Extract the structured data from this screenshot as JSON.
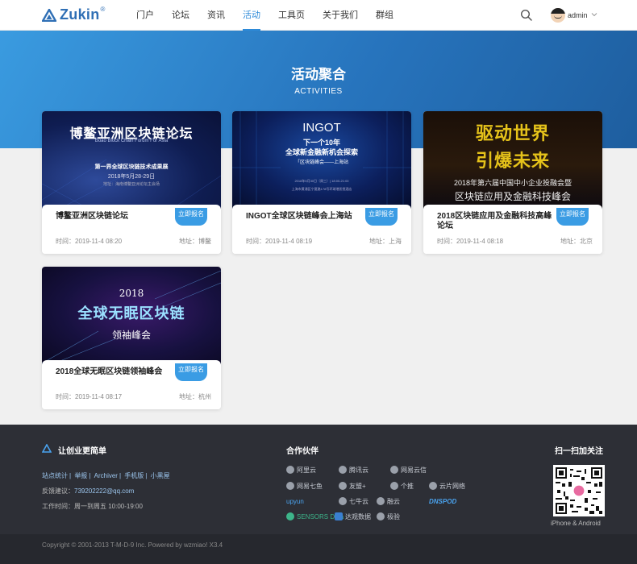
{
  "header": {
    "logo_text": "Zukin",
    "logo_mark": "®",
    "nav": [
      "门户",
      "论坛",
      "资讯",
      "活动",
      "工具页",
      "关于我们",
      "群组"
    ],
    "active_nav": "活动",
    "search_icon": "search-icon",
    "user": "admin"
  },
  "banner": {
    "title": "活动聚合",
    "subtitle": "ACTIVITIES"
  },
  "cards": [
    {
      "title": "博鳌亚洲区块链论坛",
      "badge": "立即报名",
      "time": "时间：2019-11-4 08:20",
      "address": "地址：博鳌",
      "image_text": [
        "博鳌亚洲区块链论坛",
        "Boao Block Chain Forum For Asia",
        "第一界全球区块链技术成果展",
        "2018年5月28-29日",
        "地址：海南博鳌亚洲论坛主会场"
      ]
    },
    {
      "title": "INGOT全球区块链峰会上海站",
      "badge": "立即报名",
      "time": "时间：2019-11-4 08:19",
      "address": "地址：上海",
      "image_text": [
        "INGOT",
        "下一个10年",
        "全球新金融新机会探索",
        "「区块链峰会——上海站",
        "2018年5月30日（周三）| 18:00-21:00",
        "上海市黄浦区宁夏路178号环球港凯悦酒店"
      ]
    },
    {
      "title": "2018区块链应用及金融科技高峰论坛",
      "badge": "立即报名",
      "time": "时间：2019-11-4 08:18",
      "address": "地址：北京",
      "image_text": [
        "驱动世界",
        "引爆未来",
        "2018年第六届中国中小企业投融会暨",
        "区块链应用及金融科技峰会"
      ]
    },
    {
      "title": "2018全球无眠区块链领袖峰会",
      "badge": "立即报名",
      "time": "时间：2019-11-4 08:17",
      "address": "地址：杭州",
      "image_text": [
        "2018",
        "全球无眠区块链",
        "领袖峰会"
      ]
    }
  ],
  "footer": {
    "slogan": "让创业更简单",
    "links": [
      "站点统计",
      "举报",
      "Archiver",
      "手机版",
      "小黑屋"
    ],
    "feedback_label": "反馈建议：",
    "feedback_email": "739202222@qq.com",
    "hours": "工作时间：周一到周五 10:00-19:00",
    "partners_title": "合作伙伴",
    "partners": [
      "阿里云",
      "腾讯云",
      "网易云信",
      "网易七鱼",
      "友盟+",
      "个推",
      "云片网络",
      "upyun",
      "七牛云",
      "融云",
      "DNSPOD",
      "SENSORS Data",
      "达观数据",
      "极验"
    ],
    "qr_title": "扫一扫加关注",
    "qr_caption": "iPhone & Android",
    "copyright": "Copyright © 2001-2013 T-M-D-9 Inc.  Powered by wzmiao! X3.4"
  },
  "colors": {
    "accent": "#2d8ad8",
    "banner": "#2774bd",
    "badge": "#3a9ce4",
    "footer": "#2d2f36"
  }
}
